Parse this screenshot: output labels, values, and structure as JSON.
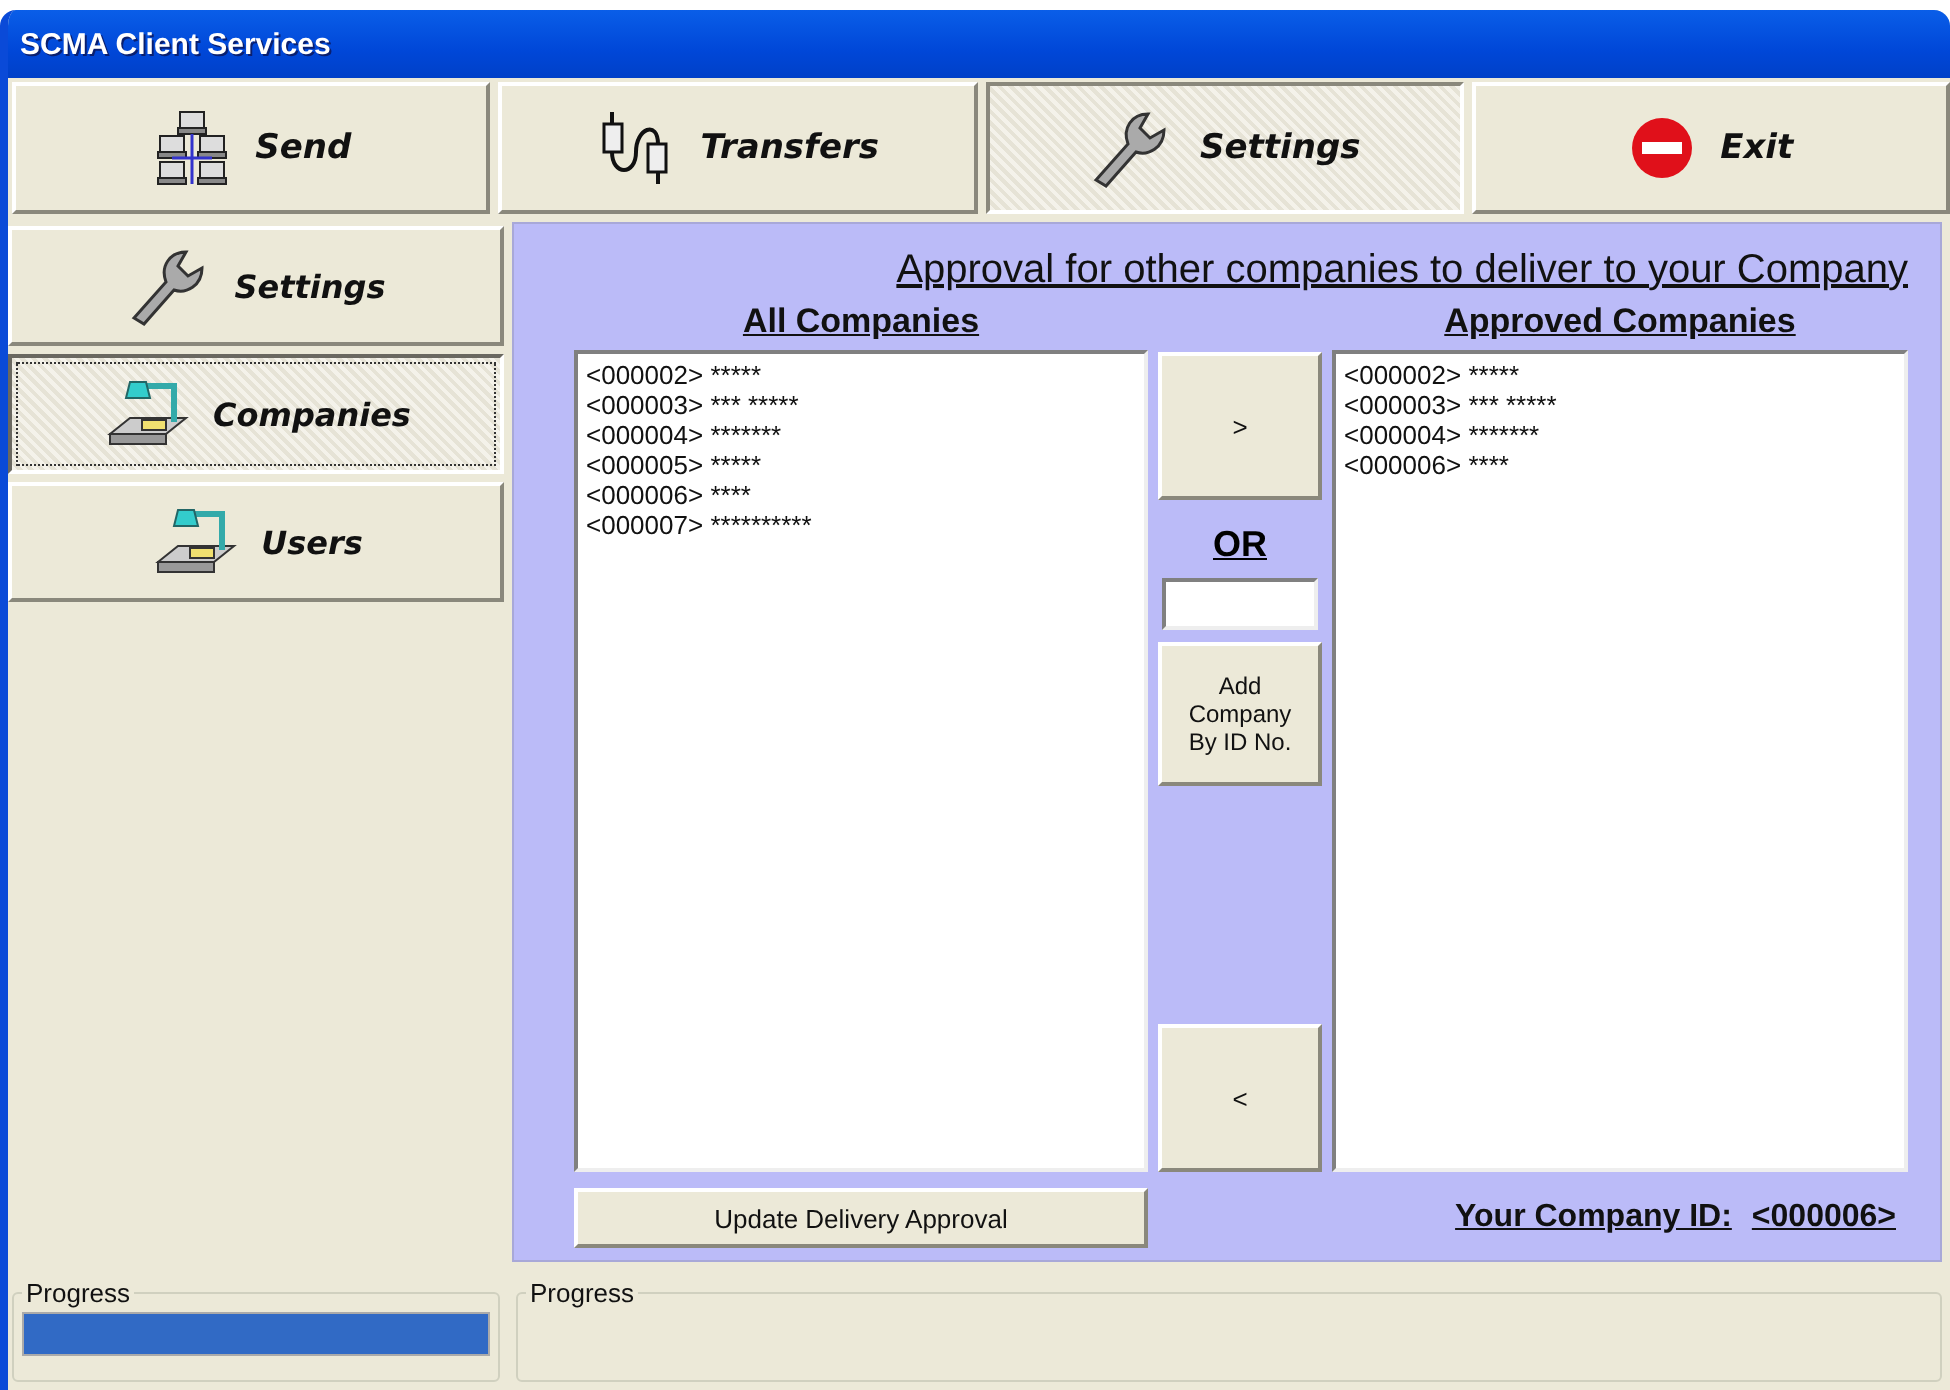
{
  "window": {
    "title": "SCMA Client Services"
  },
  "toolbar": [
    {
      "label": "Send",
      "kind": "network",
      "selected": false
    },
    {
      "label": "Transfers",
      "kind": "plug",
      "selected": false
    },
    {
      "label": "Settings",
      "kind": "wrench",
      "selected": true
    },
    {
      "label": "Exit",
      "kind": "stop",
      "selected": false
    }
  ],
  "sidebar": {
    "items": [
      {
        "label": "Settings",
        "kind": "wrench",
        "selected": false
      },
      {
        "label": "Companies",
        "kind": "lamp",
        "selected": true
      },
      {
        "label": "Users",
        "kind": "lamp",
        "selected": false
      }
    ]
  },
  "panel": {
    "heading": "Approval for other companies to deliver to your Company",
    "all_companies": {
      "title": "All Companies",
      "items": [
        {
          "id": "<000002>",
          "name": "*****"
        },
        {
          "id": "<000003>",
          "name": "*** *****"
        },
        {
          "id": "<000004>",
          "name": "*******"
        },
        {
          "id": "<000005>",
          "name": "*****"
        },
        {
          "id": "<000006>",
          "name": "****"
        },
        {
          "id": "<000007>",
          "name": "**********"
        }
      ]
    },
    "approved_companies": {
      "title": "Approved Companies",
      "items": [
        {
          "id": "<000002>",
          "name": "*****"
        },
        {
          "id": "<000003>",
          "name": "*** *****"
        },
        {
          "id": "<000004>",
          "name": "*******"
        },
        {
          "id": "<000006>",
          "name": "****"
        }
      ]
    },
    "add_button": ">",
    "or_label": "OR",
    "add_by_id_button": "Add Company By ID No.",
    "remove_button": "<",
    "update_button": "Update Delivery Approval",
    "company_id_label": "Your Company ID:",
    "company_id": "<000006>"
  },
  "status": [
    {
      "label": "Progress",
      "level": 1
    },
    {
      "label": "Progress"
    }
  ]
}
